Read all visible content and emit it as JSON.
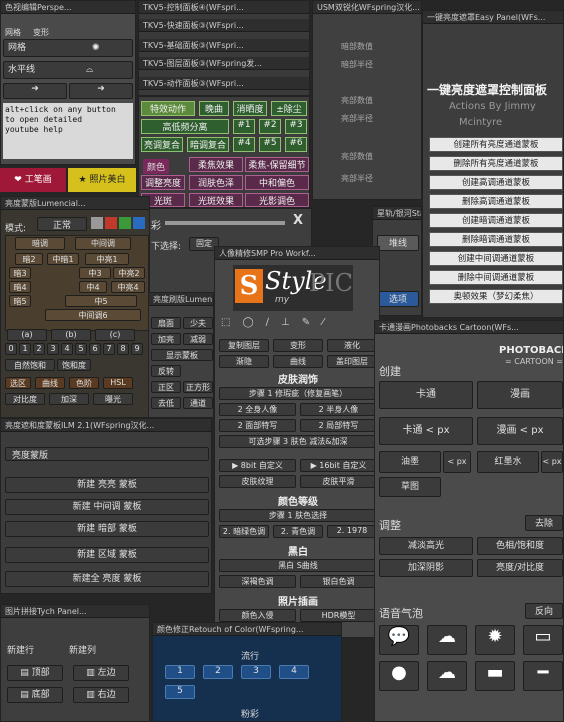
{
  "p1": {
    "title": "色视编辑Perspe...",
    "tabs": [
      "网格",
      "变形"
    ],
    "grid": "网格",
    "horizon": "水平线",
    "help": "alt+click on any button\nto open detailed\nyoutube help",
    "btn_pen": "工笔画",
    "btn_beauty": "照片美白"
  },
  "tkv": [
    "TKV5-控制面板④(WFspri...",
    "TKV5-快速面板③(WFspri...",
    "TKV5-基础面板③(WFspri...",
    "TKV5-图层面板③(WFspring发...",
    "TKV5-动作面板③(WFspri..."
  ],
  "tkv_green": {
    "row1": [
      "特效动作",
      "晚曲",
      "消晒度",
      "±除尘"
    ],
    "row2": [
      "高低频分离",
      "#1",
      "#2",
      "#3"
    ],
    "row3": [
      "亮调复合",
      "暗调复合",
      "#4",
      "#5",
      "#6"
    ],
    "row4": [
      "颜色",
      "柔焦效果",
      "柔焦-保留细节"
    ],
    "row5": [
      "调整亮度",
      "润肤色泽",
      "中和偏色"
    ],
    "row6": [
      "光斑",
      "光斑效果",
      "光影调色"
    ]
  },
  "usm": {
    "title": "USM双锐化WFspring汉化...",
    "rows": [
      "暗部数值",
      "暗部半径",
      "亮部数值",
      "亮部半径",
      "亮部数值",
      "亮部半径"
    ]
  },
  "easy": {
    "title": "一键亮度遮罩Easy Panel(WFs...",
    "heading": "一键亮度遮罩控制面板",
    "sub1": "Actions By Jimmy",
    "sub2": "Mcintyre",
    "buttons": [
      "创建所有亮度通道蒙板",
      "删除所有亮度通道蒙板",
      "创建高调通道蒙板",
      "删除高调通道蒙板",
      "创建暗调通道蒙板",
      "删除暗调通道蒙板",
      "创建中间调通道蒙板",
      "删除中间调通道蒙板",
      "奥顿效果（梦幻柔焦）"
    ]
  },
  "lum": {
    "title": "亮度蒙版Lumencial...",
    "mode": "模式:",
    "normal": "正常",
    "cells": [
      "暗调",
      "中间调",
      "暗2",
      "中暗1",
      "中亮1",
      "暗3",
      "中3",
      "中亮2",
      "暗4",
      "中4",
      "中亮4",
      "暗5",
      "中5",
      "中间调6"
    ],
    "abc": [
      "(a)",
      "(b)",
      "(c)"
    ],
    "nums": [
      "0",
      "1",
      "2",
      "3",
      "4",
      "5",
      "6",
      "7",
      "8",
      "9"
    ],
    "ops": [
      "自然饱和",
      "饱和度"
    ],
    "sel": [
      "选区",
      "曲线",
      "色阶",
      "HSL"
    ],
    "cmp": [
      "对比度",
      "加深",
      "曝光"
    ]
  },
  "lum_small": {
    "title": "亮度刷版Lumen...",
    "items": [
      "扇面",
      "少夫",
      "加亮",
      "减弱",
      "显示蒙板",
      "反转",
      "正区",
      "正方形",
      "去低",
      "通道"
    ]
  },
  "tone": {
    "label": "颜色",
    "select_label": "下选择:",
    "select_value": "固定",
    "btn_en": "英文",
    "btn_switch": "切换"
  },
  "star": {
    "title": "星轨/银河Star...",
    "b1": "堆线",
    "b2": "选项"
  },
  "smp": {
    "title": "人像精修SMP Pro Workf...",
    "logo_main": "Style",
    "logo_sub": "my",
    "logo_pic": "PIC",
    "rows": [
      [
        "复制图层",
        "变形",
        "液化"
      ],
      [
        "渐隐",
        "曲线",
        "盖印图层"
      ]
    ],
    "s1": "皮肤润饰",
    "s1_items": [
      "步骤 1 修瑕疵（修复画笔）",
      "2 全身人像",
      "2 半身人像",
      "2 面部特写",
      "2 局部特写",
      "可选步骤 3 肤色 减法&加深"
    ],
    "bit": [
      "▶ 8bit 自定义",
      "▶ 16bit 自定义"
    ],
    "skin": [
      "皮肤纹理",
      "皮肤平滑"
    ],
    "s2": "颜色等级",
    "s2_items": [
      "步骤 1 肤色选择",
      "2. 暗绿色调",
      "2. 青色调",
      "2. 1978"
    ],
    "s3": "黑白",
    "s3_items": [
      "黑白 S曲线",
      "深褐色调",
      "银白色调"
    ],
    "s4": "照片插画",
    "s4_items": [
      "颜色入侵",
      "HDR模型"
    ]
  },
  "bw": {
    "title": "亮度遮和度蒙板ILM 2.1(WFspring汉化...",
    "select": "亮度蒙版",
    "buttons": [
      "新建 亮亮 蒙板",
      "新建 中间调 蒙板",
      "新建 暗部 蒙板",
      "新建 区域 蒙板",
      "新建全 亮度 蒙板"
    ]
  },
  "tych": {
    "title": "图片拼接Tych Panel...",
    "new_row": "新建行",
    "new_col": "新建列",
    "top": "顶部",
    "bottom": "底部",
    "left": "左边",
    "right": "右边"
  },
  "retouch": {
    "title": "颜色修正Retouch of Color(WFspring...",
    "group1": "流行",
    "nums1": [
      "1",
      "2",
      "3",
      "4",
      "5"
    ],
    "group2": "粉彩",
    "nums2": [
      "1",
      "2",
      "3",
      "4"
    ]
  },
  "pb": {
    "title": "卡通漫画Photobacks Cartoon(WFs...",
    "logo1": "PHOTOBACKS",
    "logo2": "= CARTOON =",
    "create": "创建",
    "cartoon": "卡通",
    "comic": "漫画",
    "cartoon_px": "卡通 < px",
    "comic_px": "漫画 < px",
    "oil": "油墨",
    "px": "< px",
    "red": "红墨水",
    "draft": "草图",
    "adjust": "调整",
    "remove": "去除",
    "reduce": "减淡高光",
    "hue": "色相/饱和度",
    "shadow": "加深阴影",
    "bright": "亮度/对比度",
    "bubble": "语音气泡",
    "reverse": "反向"
  },
  "slider_label": "彩",
  "close_x": "X"
}
